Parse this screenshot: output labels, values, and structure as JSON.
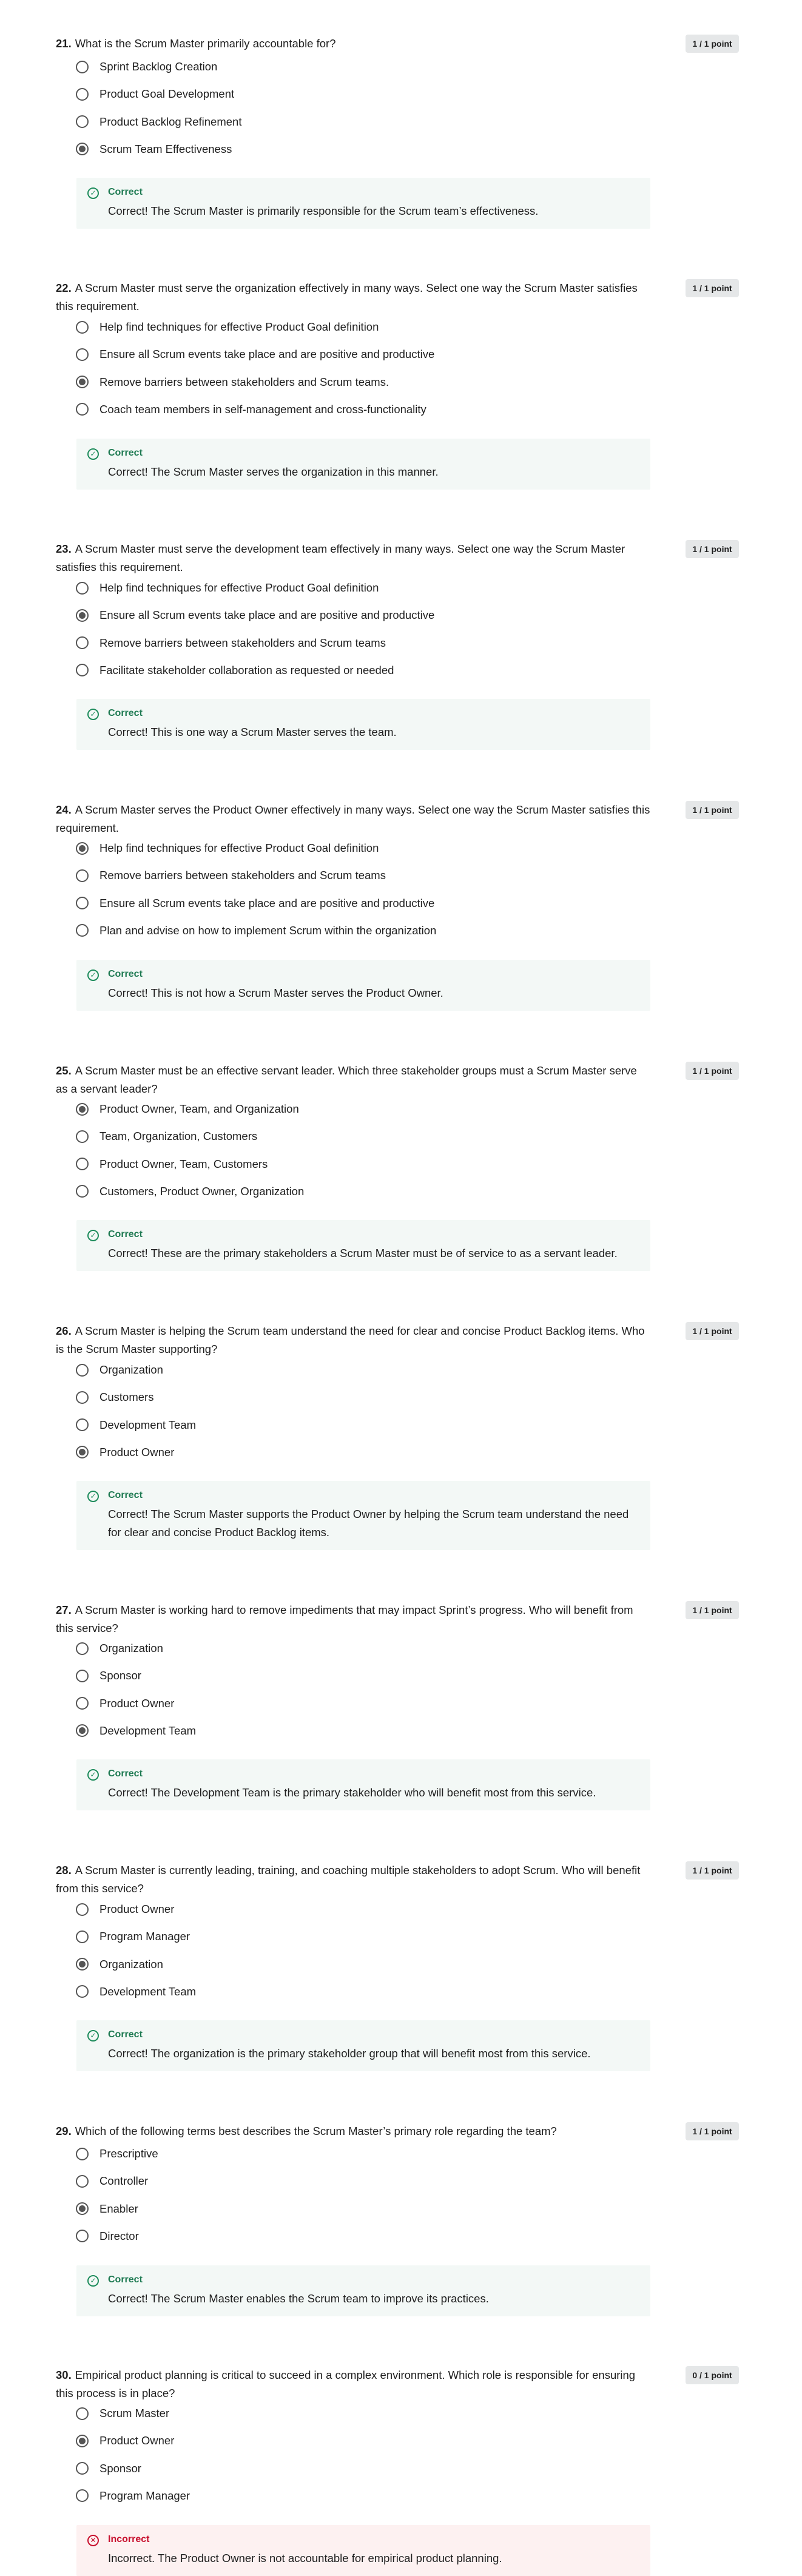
{
  "questions": [
    {
      "number": "21.",
      "text": "What is the Scrum Master primarily accountable for?",
      "points": "1 / 1 point",
      "options": [
        {
          "label": "Sprint Backlog Creation",
          "selected": false
        },
        {
          "label": "Product Goal Development",
          "selected": false
        },
        {
          "label": "Product Backlog Refinement",
          "selected": false
        },
        {
          "label": "Scrum Team Effectiveness",
          "selected": true
        }
      ],
      "feedback": {
        "status": "Correct",
        "text": "Correct! The Scrum Master is primarily responsible for the Scrum team’s effectiveness.",
        "correct": true
      }
    },
    {
      "number": "22.",
      "text": "A Scrum Master must serve the organization effectively in many ways. Select one way the Scrum Master satisfies this requirement.",
      "points": "1 / 1 point",
      "options": [
        {
          "label": "Help find techniques for effective Product Goal definition",
          "selected": false
        },
        {
          "label": "Ensure all Scrum events take place and are positive and productive",
          "selected": false
        },
        {
          "label": "Remove barriers between stakeholders and Scrum teams.",
          "selected": true
        },
        {
          "label": "Coach team members in self-management and cross-functionality",
          "selected": false
        }
      ],
      "feedback": {
        "status": "Correct",
        "text": "Correct! The Scrum Master serves the organization in this manner.",
        "correct": true
      }
    },
    {
      "number": "23.",
      "text": "A Scrum Master must serve the development team effectively in many ways. Select one way the Scrum Master satisfies this requirement.",
      "points": "1 / 1 point",
      "options": [
        {
          "label": "Help find techniques for effective Product Goal definition",
          "selected": false
        },
        {
          "label": "Ensure all Scrum events take place and are positive and productive",
          "selected": true
        },
        {
          "label": "Remove barriers between stakeholders and Scrum teams",
          "selected": false
        },
        {
          "label": "Facilitate stakeholder collaboration as requested or needed",
          "selected": false
        }
      ],
      "feedback": {
        "status": "Correct",
        "text": "Correct! This is one way a Scrum Master serves the team.",
        "correct": true
      }
    },
    {
      "number": "24.",
      "text": "A Scrum Master serves the Product Owner effectively in many ways. Select one way the Scrum Master satisfies this requirement.",
      "points": "1 / 1 point",
      "options": [
        {
          "label": "Help find techniques for effective Product Goal definition",
          "selected": true
        },
        {
          "label": "Remove barriers between stakeholders and Scrum teams",
          "selected": false
        },
        {
          "label": "Ensure all Scrum events take place and are positive and productive",
          "selected": false
        },
        {
          "label": "Plan and advise on how to implement Scrum within the organization",
          "selected": false
        }
      ],
      "feedback": {
        "status": "Correct",
        "text": "Correct! This is not how a Scrum Master serves the Product Owner.",
        "correct": true
      }
    },
    {
      "number": "25.",
      "text": "A Scrum Master must be an effective servant leader. Which three stakeholder groups must a Scrum Master serve as a servant leader?",
      "points": "1 / 1 point",
      "options": [
        {
          "label": "Product Owner, Team, and Organization",
          "selected": true
        },
        {
          "label": "Team, Organization, Customers",
          "selected": false
        },
        {
          "label": "Product Owner, Team, Customers",
          "selected": false
        },
        {
          "label": "Customers, Product Owner, Organization",
          "selected": false
        }
      ],
      "feedback": {
        "status": "Correct",
        "text": "Correct! These are the primary stakeholders a Scrum Master must be of service to as a servant leader.",
        "correct": true
      }
    },
    {
      "number": "26.",
      "text": "A Scrum Master is helping the Scrum team understand the need for clear and concise Product Backlog items. Who is the Scrum Master supporting?",
      "points": "1 / 1 point",
      "options": [
        {
          "label": "Organization",
          "selected": false
        },
        {
          "label": "Customers",
          "selected": false
        },
        {
          "label": "Development Team",
          "selected": false
        },
        {
          "label": "Product Owner",
          "selected": true
        }
      ],
      "feedback": {
        "status": "Correct",
        "text": "Correct! The Scrum Master supports the Product Owner by helping the Scrum team understand the need for clear and concise Product Backlog items.",
        "correct": true
      }
    },
    {
      "number": "27.",
      "text": "A Scrum Master is working hard to remove impediments that may impact Sprint’s progress. Who will benefit from this service?",
      "points": "1 / 1 point",
      "options": [
        {
          "label": "Organization",
          "selected": false
        },
        {
          "label": "Sponsor",
          "selected": false
        },
        {
          "label": "Product Owner",
          "selected": false
        },
        {
          "label": "Development Team",
          "selected": true
        }
      ],
      "feedback": {
        "status": "Correct",
        "text": "Correct! The Development Team is the primary stakeholder who will benefit most from this service.",
        "correct": true
      }
    },
    {
      "number": "28.",
      "text": "A Scrum Master is currently leading, training, and coaching multiple stakeholders to adopt Scrum. Who will benefit from this service?",
      "points": "1 / 1 point",
      "options": [
        {
          "label": "Product Owner",
          "selected": false
        },
        {
          "label": "Program Manager",
          "selected": false
        },
        {
          "label": "Organization",
          "selected": true
        },
        {
          "label": "Development Team",
          "selected": false
        }
      ],
      "feedback": {
        "status": "Correct",
        "text": "Correct! The organization is the primary stakeholder group that will benefit most from this service.",
        "correct": true
      }
    },
    {
      "number": "29.",
      "text": "Which of the following terms best describes the Scrum Master’s primary role regarding the team?",
      "points": "1 / 1 point",
      "options": [
        {
          "label": "Prescriptive",
          "selected": false
        },
        {
          "label": "Controller",
          "selected": false
        },
        {
          "label": "Enabler",
          "selected": true
        },
        {
          "label": "Director",
          "selected": false
        }
      ],
      "feedback": {
        "status": "Correct",
        "text": "Correct! The Scrum Master enables the Scrum team to improve its practices.",
        "correct": true
      }
    },
    {
      "number": "30.",
      "text": "Empirical product planning is critical to succeed in a complex environment. Which role is responsible for ensuring this process is in place?",
      "points": "0 / 1 point",
      "options": [
        {
          "label": "Scrum Master",
          "selected": false
        },
        {
          "label": "Product Owner",
          "selected": true
        },
        {
          "label": "Sponsor",
          "selected": false
        },
        {
          "label": "Program Manager",
          "selected": false
        }
      ],
      "feedback": {
        "status": "Incorrect",
        "text": "Incorrect. The Product Owner is not accountable for empirical product planning.",
        "correct": false
      }
    }
  ]
}
